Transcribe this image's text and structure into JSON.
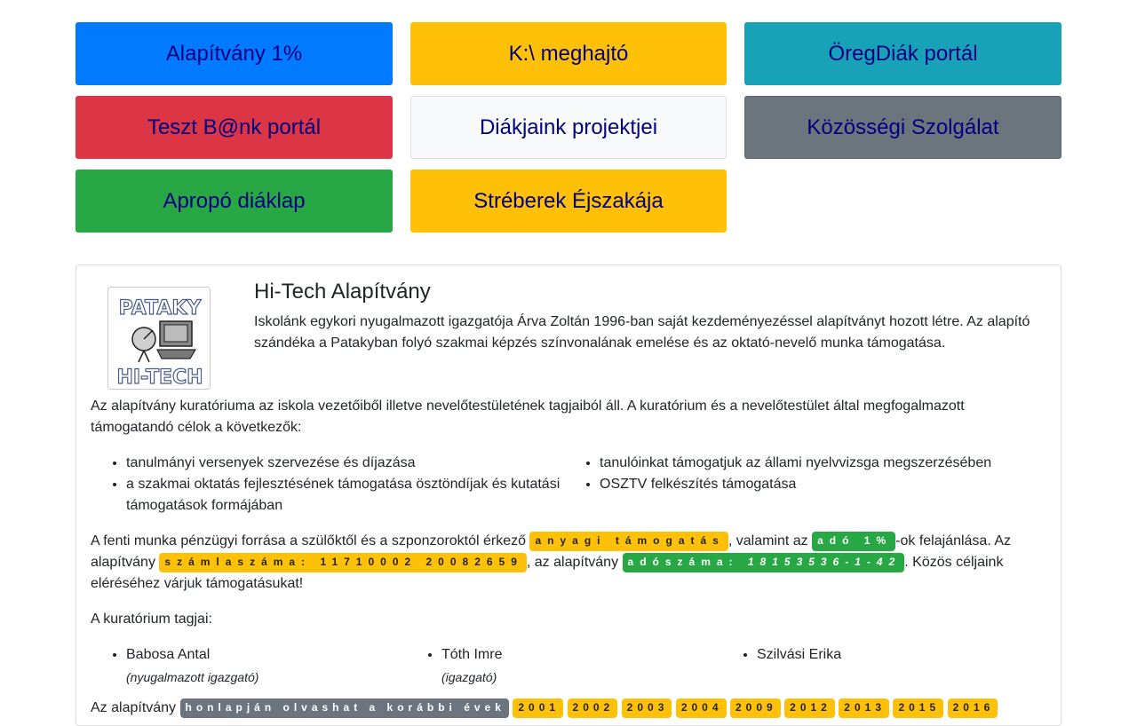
{
  "portals": [
    {
      "label": "Alapítvány 1%",
      "color": "#007bff"
    },
    {
      "label": "K:\\ meghajtó",
      "color": "#ffc107"
    },
    {
      "label": "ÖregDiák portál",
      "color": "#17a2b8"
    },
    {
      "label": "Teszt B@nk portál",
      "color": "#dc3545"
    },
    {
      "label": "Diákjaink projektjei",
      "color": "#f8f9fa"
    },
    {
      "label": "Közösségi Szolgálat",
      "color": "#6c757d"
    },
    {
      "label": "Apropó diáklap",
      "color": "#28a745"
    },
    {
      "label": "Stréberek Éjszakája",
      "color": "#ffc107"
    }
  ],
  "card": {
    "logo_text_top": "PATAKY",
    "logo_text_bottom": "HI-TECH",
    "title": "Hi-Tech Alapítvány",
    "intro": "Iskolánk egykori nyugalmazott igazgatója Árva Zoltán 1996-ban saját kezdeményezéssel alapítványt hozott létre. Az alapító szándéka a Patakyban folyó szakmai képzés színvonalának emelése és az oktató-nevelő munka támogatása.",
    "curatorium_text": "Az alapítvány kuratóriuma az iskola vezetőiből illetve nevelőtestületének tagjaiból áll. A kuratórium és a nevelőtestület által megfogalmazott támogatandó célok a következők:",
    "goals_left": [
      "tanulmányi versenyek szervezése és díjazása",
      "a szakmai oktatás fejlesztésének támogatása ösztöndíjak és kutatási támogatások formájában"
    ],
    "goals_right": [
      "tanulóinkat támogatjuk az állami nyelvvizsga megszerzésében",
      "OSZTV felkészítés támogatása"
    ],
    "funding": {
      "text1": "A fenti munka pénzügyi forrása a szülőktől és a szponzoroktól érkező ",
      "badge1": "anyagi támogatás",
      "text2": ", valamint az ",
      "badge2": "adó 1%",
      "text3": "-ok felajánlása. Az alapítvány ",
      "badge3": "számlaszáma: 11710002 20082659",
      "text4": ", az alapítvány ",
      "badge4_label": "adószáma: ",
      "badge4_value": "18153536-1-42",
      "text5": ". Közös céljaink eléréséhez várjuk támogatásukat!"
    },
    "members_title": "A kuratórium tagjai:",
    "members": [
      {
        "name": "Babosa Antal",
        "role": "(nyugalmazott igazgató)"
      },
      {
        "name": "Tóth Imre",
        "role": "(igazgató)"
      },
      {
        "name": "Szilvási Erika",
        "role": ""
      }
    ],
    "bottom": {
      "text": "Az alapítvány ",
      "badge": "honlapján olvashat a korábbi évek",
      "years": [
        "2001",
        "2002",
        "2003",
        "2004",
        "2009",
        "2012",
        "2013",
        "2015",
        "2016"
      ]
    }
  }
}
